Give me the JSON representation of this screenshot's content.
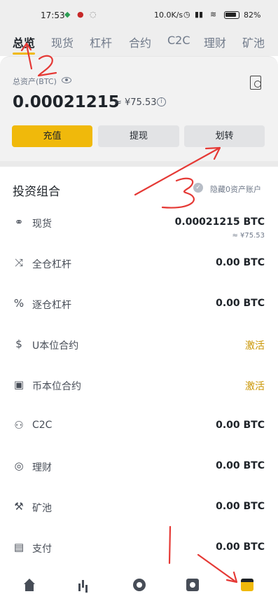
{
  "status_bar": {
    "time": "17:53",
    "network_speed": "10.0K/s",
    "battery": "82%"
  },
  "tabs": [
    {
      "label": "总览",
      "active": true
    },
    {
      "label": "现货",
      "active": false
    },
    {
      "label": "杠杆",
      "active": false
    },
    {
      "label": "合约",
      "active": false
    },
    {
      "label": "C2C",
      "active": false
    },
    {
      "label": "理财",
      "active": false
    },
    {
      "label": "矿池",
      "active": false
    }
  ],
  "summary": {
    "asset_label": "总资产(BTC)",
    "balance": "0.00021215",
    "approx_cny": "≈ ¥75.53"
  },
  "actions": {
    "deposit": "充值",
    "withdraw": "提现",
    "transfer": "划转"
  },
  "portfolio": {
    "title": "投资组合",
    "hide_zero_label": "隐藏0资产账户",
    "rows": [
      {
        "name": "现货",
        "value": "0.00021215 BTC",
        "sub": "≈ ¥75.53",
        "icon": "spot-icon"
      },
      {
        "name": "全仓杠杆",
        "value": "0.00 BTC",
        "icon": "cross-margin-icon"
      },
      {
        "name": "逐仓杠杆",
        "value": "0.00 BTC",
        "icon": "isolated-margin-icon"
      },
      {
        "name": "U本位合约",
        "value": "激活",
        "activate": true,
        "icon": "usdm-futures-icon"
      },
      {
        "name": "币本位合约",
        "value": "激活",
        "activate": true,
        "icon": "coinm-futures-icon"
      },
      {
        "name": "C2C",
        "value": "0.00 BTC",
        "icon": "c2c-icon"
      },
      {
        "name": "理财",
        "value": "0.00 BTC",
        "icon": "earn-icon"
      },
      {
        "name": "矿池",
        "value": "0.00 BTC",
        "icon": "pool-icon"
      },
      {
        "name": "支付",
        "value": "0.00 BTC",
        "icon": "pay-icon"
      }
    ]
  },
  "colors": {
    "accent": "#f0b90b",
    "activate_text": "#c99400",
    "annotation_red": "#e53935"
  },
  "annotations": [
    "2",
    "3",
    "1"
  ]
}
